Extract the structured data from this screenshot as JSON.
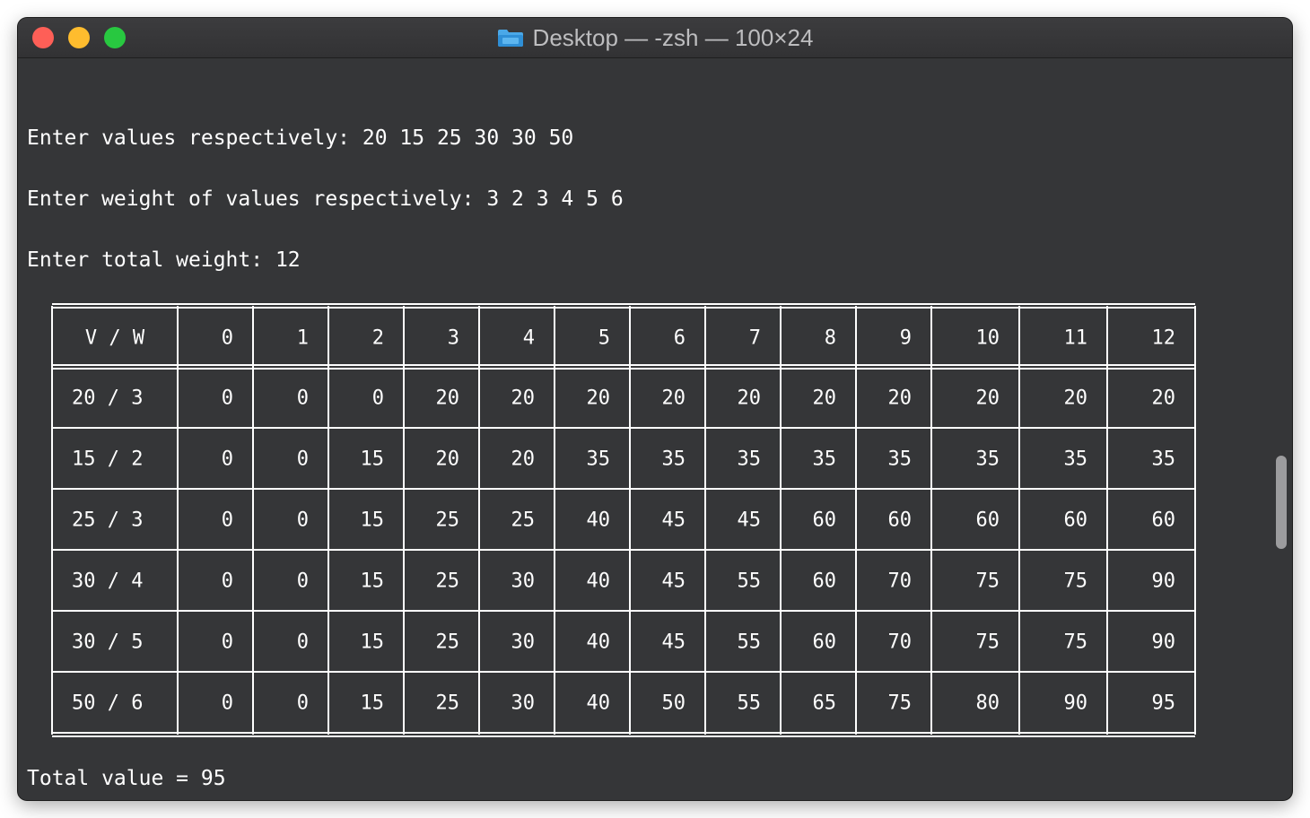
{
  "window": {
    "title": "Desktop — -zsh — 100×24"
  },
  "terminal": {
    "lines": {
      "values": "Enter values respectively: 20 15 25 30 30 50",
      "weights": "Enter weight of values respectively: 3 2 3 4 5 6",
      "capacity": "Enter total weight: 12",
      "total": "Total value = 95"
    },
    "table": {
      "header": [
        "V / W",
        "0",
        "1",
        "2",
        "3",
        "4",
        "5",
        "6",
        "7",
        "8",
        "9",
        "10",
        "11",
        "12"
      ],
      "rows": [
        {
          "label": "20 / 3",
          "values": [
            "0",
            "0",
            "0",
            "20",
            "20",
            "20",
            "20",
            "20",
            "20",
            "20",
            "20",
            "20",
            "20"
          ]
        },
        {
          "label": "15 / 2",
          "values": [
            "0",
            "0",
            "15",
            "20",
            "20",
            "35",
            "35",
            "35",
            "35",
            "35",
            "35",
            "35",
            "35"
          ]
        },
        {
          "label": "25 / 3",
          "values": [
            "0",
            "0",
            "15",
            "25",
            "25",
            "40",
            "45",
            "45",
            "60",
            "60",
            "60",
            "60",
            "60"
          ]
        },
        {
          "label": "30 / 4",
          "values": [
            "0",
            "0",
            "15",
            "25",
            "30",
            "40",
            "45",
            "55",
            "60",
            "70",
            "75",
            "75",
            "90"
          ]
        },
        {
          "label": "30 / 5",
          "values": [
            "0",
            "0",
            "15",
            "25",
            "30",
            "40",
            "45",
            "55",
            "60",
            "70",
            "75",
            "75",
            "90"
          ]
        },
        {
          "label": "50 / 6",
          "values": [
            "0",
            "0",
            "15",
            "25",
            "30",
            "40",
            "50",
            "55",
            "65",
            "75",
            "80",
            "90",
            "95"
          ]
        }
      ]
    }
  },
  "colors": {
    "background": "#353638",
    "text": "#ffffff",
    "close": "#fe5f57",
    "minimize": "#febc2e",
    "maximize": "#28c840"
  }
}
